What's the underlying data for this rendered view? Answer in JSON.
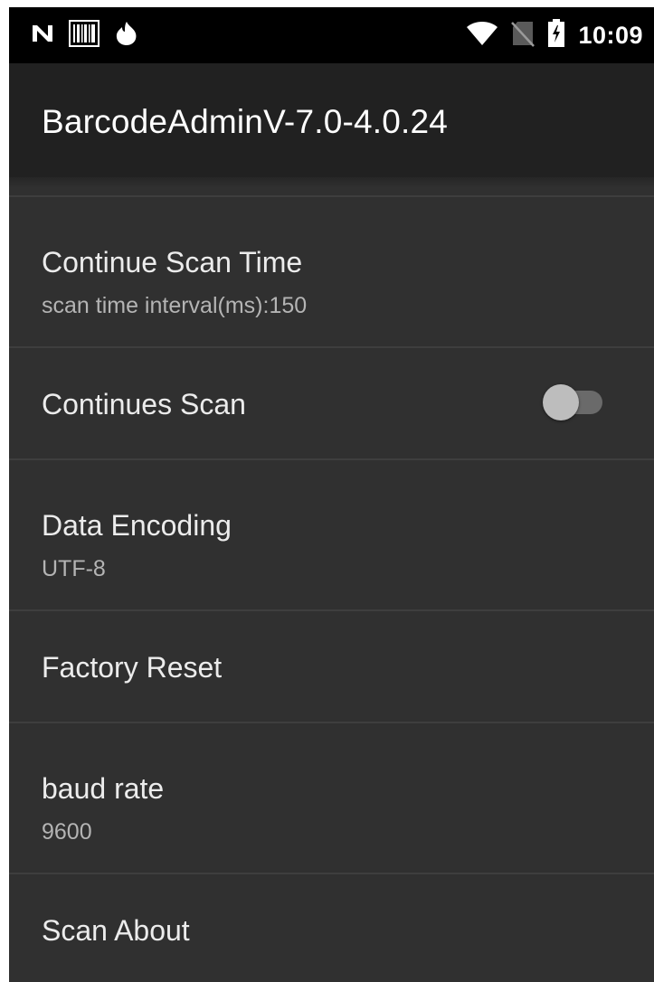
{
  "status_bar": {
    "time": "10:09",
    "icons_left": [
      "notification-n-icon",
      "barcode-icon",
      "flame-icon"
    ],
    "icons_right": [
      "wifi-icon",
      "no-sim-icon",
      "battery-icon"
    ]
  },
  "app_bar": {
    "title": "BarcodeAdminV-7.0-4.0.24"
  },
  "preferences": [
    {
      "title": "Continue Scan Time",
      "summary": "scan time interval(ms):150"
    },
    {
      "title": "Continues Scan",
      "switch_on": false
    },
    {
      "title": "Data Encoding",
      "summary": "UTF-8"
    },
    {
      "title": "Factory Reset"
    },
    {
      "title": "baud rate",
      "summary": "9600"
    },
    {
      "title": "Scan About"
    }
  ],
  "colors": {
    "background": "#303030",
    "app_bar": "#212121",
    "status_bar": "#000000",
    "primary_text": "#ececec",
    "secondary_text": "#b4b4b4"
  }
}
